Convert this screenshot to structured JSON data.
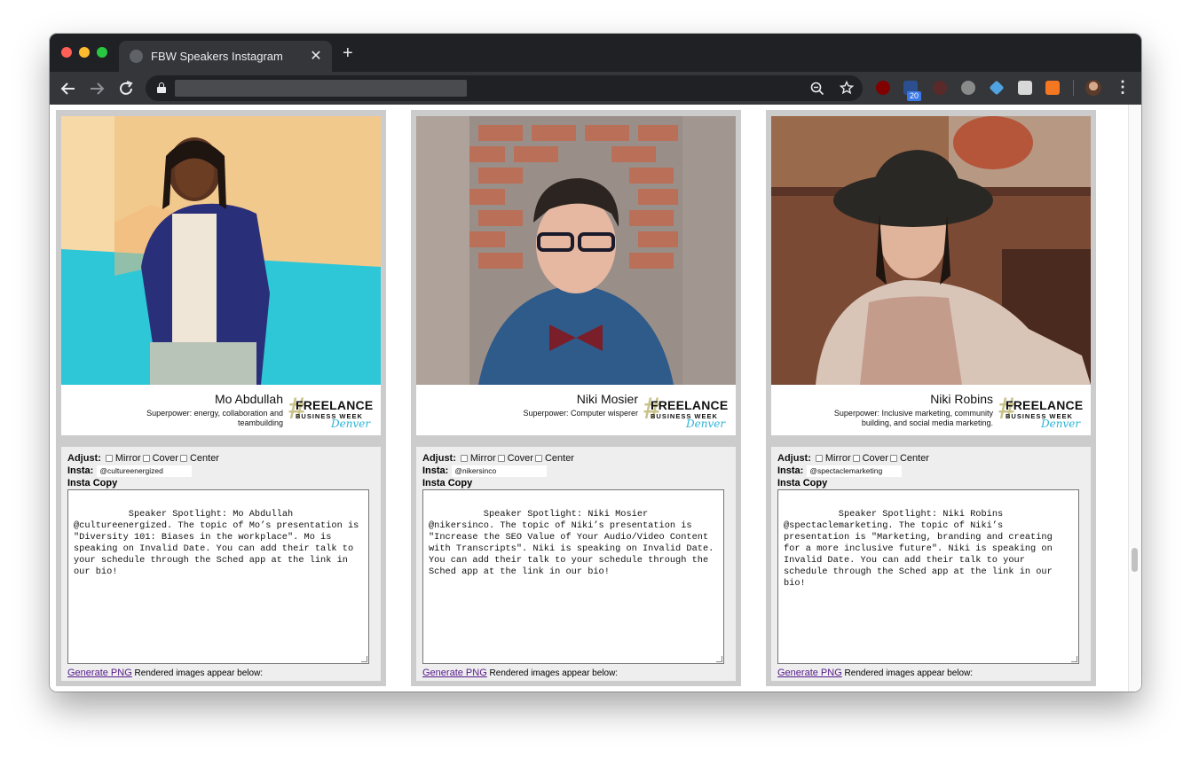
{
  "browser": {
    "tab_title": "FBW Speakers Instagram",
    "tab_close": "✕",
    "new_tab": "+",
    "ext_badge_count": "20"
  },
  "speakers": [
    {
      "name": "Mo Abdullah",
      "superpower": "Superpower: energy, collaboration and teambuilding",
      "insta": "@cultureenergized",
      "copy": "Speaker Spotlight: Mo Abdullah @cultureenergized. The topic of Mo’s presentation is \"Diversity 101: Biases in the workplace\". Mo is speaking on Invalid Date. You can add their talk to your schedule through the Sched app at the link in our bio!"
    },
    {
      "name": "Niki Mosier",
      "superpower": "Superpower: Computer wisperer",
      "insta": "@nikersinco",
      "copy": "Speaker Spotlight: Niki Mosier @nikersinco. The topic of Niki’s presentation is \"Increase the SEO Value of Your Audio/Video Content with Transcripts\". Niki is speaking on Invalid Date. You can add their talk to your schedule through the Sched app at the link in our bio!"
    },
    {
      "name": "Niki Robins",
      "superpower": "Superpower: Inclusive marketing, community building, and social media marketing.",
      "insta": "@spectaclemarketing",
      "copy": "Speaker Spotlight: Niki Robins @spectaclemarketing. The topic of Niki’s presentation is \"Marketing, branding and creating for a more inclusive future\". Niki is speaking on Invalid Date. You can add their talk to your schedule through the Sched app at the link in our bio!"
    }
  ],
  "logo": {
    "line1": "FREELANCE",
    "line2": "BUSINESS WEEK",
    "line3": "Denver",
    "hash": "#"
  },
  "labels": {
    "adjust": "Adjust:",
    "mirror": "Mirror",
    "cover": "Cover",
    "center": "Center",
    "insta": "Insta:",
    "insta_copy": "Insta Copy",
    "generate": "Generate PNG",
    "rendered": "Rendered images appear below:"
  },
  "colors": {
    "tabbar": "#202124",
    "toolbar": "#35363a",
    "card_bg": "#cccccc",
    "controls_bg": "#eeeeee",
    "link": "#551a8b",
    "logo_accent": "#2bb3d6"
  }
}
